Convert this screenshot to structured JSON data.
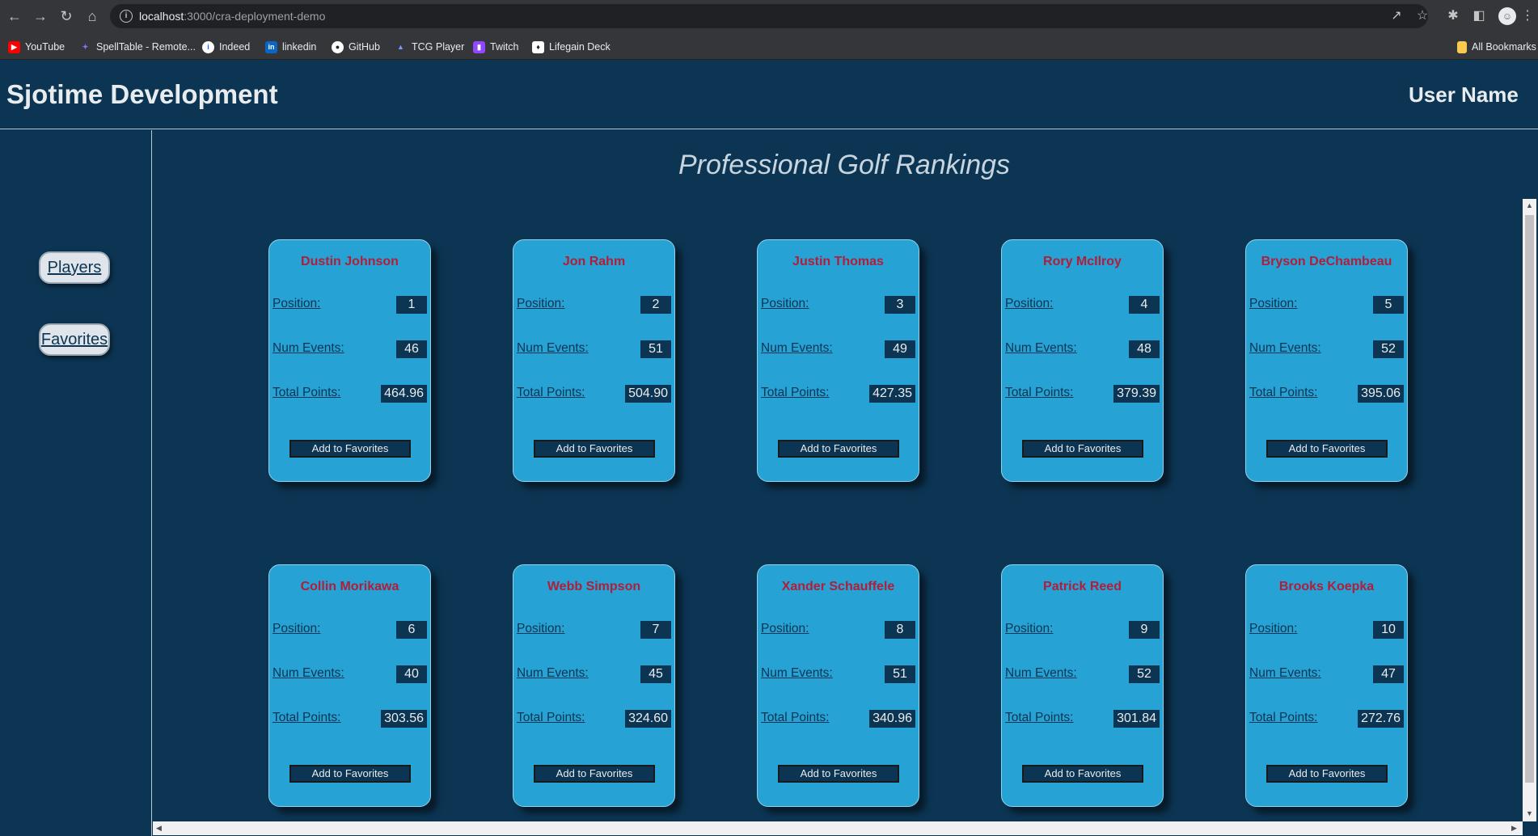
{
  "browser": {
    "url_host": "localhost",
    "url_path": ":3000/cra-deployment-demo",
    "bookmarks": [
      {
        "label": "YouTube",
        "icon": "youtube-icon",
        "color": "#ff0000"
      },
      {
        "label": "SpellTable - Remote...",
        "icon": "spelltable-icon",
        "color": "#7b5cff"
      },
      {
        "label": "Indeed",
        "icon": "indeed-icon",
        "color": "#ffffff"
      },
      {
        "label": "linkedin",
        "icon": "linkedin-icon",
        "color": "#0a66c2"
      },
      {
        "label": "GitHub",
        "icon": "github-icon",
        "color": "#ffffff"
      },
      {
        "label": "TCG Player",
        "icon": "tcgplayer-icon",
        "color": "#3b6fd8"
      },
      {
        "label": "Twitch",
        "icon": "twitch-icon",
        "color": "#9146ff"
      },
      {
        "label": "Lifegain Deck",
        "icon": "lifegain-deck-icon",
        "color": "#ffffff"
      }
    ],
    "all_bookmarks_label": "All Bookmarks"
  },
  "header": {
    "title": "Sjotime Development",
    "user_name": "User Name"
  },
  "sidebar": {
    "items": [
      {
        "label": "Players"
      },
      {
        "label": "Favorites"
      }
    ]
  },
  "main": {
    "title": "Professional Golf Rankings",
    "labels": {
      "position": "Position:",
      "num_events": "Num Events:",
      "total_points": "Total Points:",
      "add_favorites": "Add to Favorites"
    },
    "players": [
      {
        "name": "Dustin Johnson",
        "position": "1",
        "num_events": "46",
        "total_points": "464.96"
      },
      {
        "name": "Jon Rahm",
        "position": "2",
        "num_events": "51",
        "total_points": "504.90"
      },
      {
        "name": "Justin Thomas",
        "position": "3",
        "num_events": "49",
        "total_points": "427.35"
      },
      {
        "name": "Rory McIlroy",
        "position": "4",
        "num_events": "48",
        "total_points": "379.39"
      },
      {
        "name": "Bryson DeChambeau",
        "position": "5",
        "num_events": "52",
        "total_points": "395.06"
      },
      {
        "name": "Collin Morikawa",
        "position": "6",
        "num_events": "40",
        "total_points": "303.56"
      },
      {
        "name": "Webb Simpson",
        "position": "7",
        "num_events": "45",
        "total_points": "324.60"
      },
      {
        "name": "Xander Schauffele",
        "position": "8",
        "num_events": "51",
        "total_points": "340.96"
      },
      {
        "name": "Patrick Reed",
        "position": "9",
        "num_events": "52",
        "total_points": "301.84"
      },
      {
        "name": "Brooks Koepka",
        "position": "10",
        "num_events": "47",
        "total_points": "272.76"
      }
    ]
  },
  "colors": {
    "background": "#0c3553",
    "card": "#27a2d4",
    "player_name": "#b01e3a"
  }
}
